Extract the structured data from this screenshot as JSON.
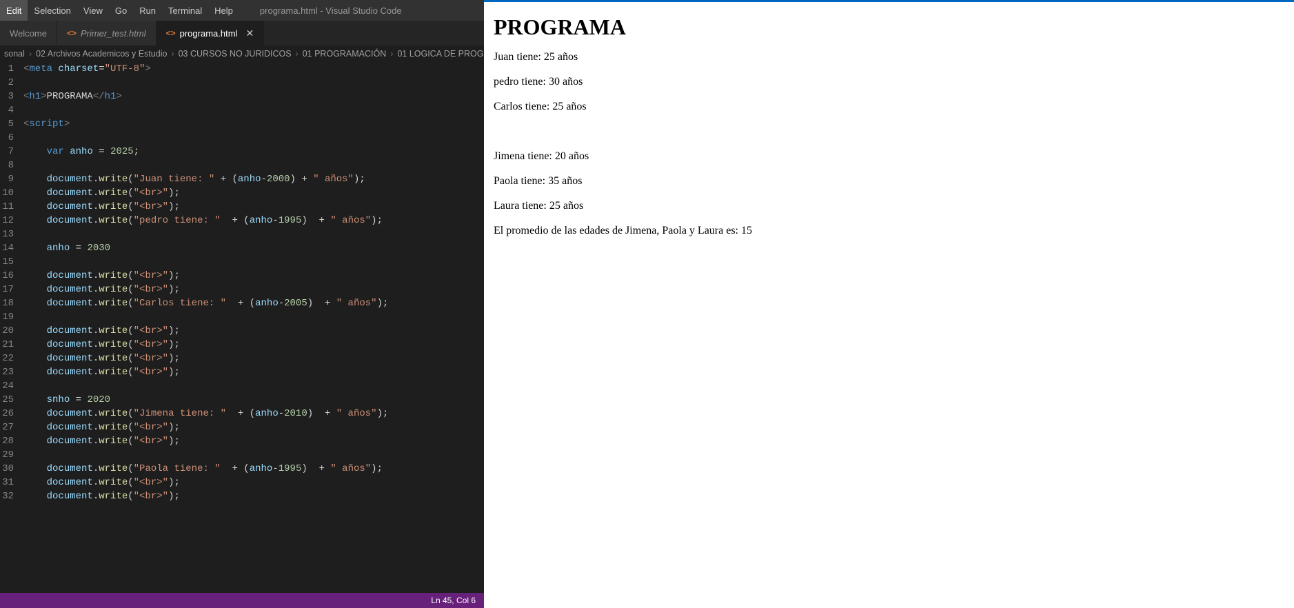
{
  "menubar": {
    "items": [
      "Edit",
      "Selection",
      "View",
      "Go",
      "Run",
      "Terminal",
      "Help"
    ],
    "title": "programa.html - Visual Studio Code"
  },
  "tabs": [
    {
      "label": "Welcome",
      "icon": "",
      "active": false,
      "welcome": true
    },
    {
      "label": "Primer_test.html",
      "icon": "<>",
      "active": false
    },
    {
      "label": "programa.html",
      "icon": "<>",
      "active": true,
      "close": "✕"
    }
  ],
  "breadcrumbs": [
    "sonal",
    "02 Archivos Academicos y Estudio",
    "03 CURSOS NO JURIDICOS",
    "01 PROGRAMACIÓN",
    "01 LOGICA DE PROG"
  ],
  "statusbar": {
    "position": "Ln 45, Col 6"
  },
  "code_lines": [
    {
      "n": 1,
      "html": "<span class='t-punct'>&lt;</span><span class='t-tag'>meta</span> <span class='t-attr'>charset</span><span class='t-txt'>=</span><span class='t-str'>\"UTF-8\"</span><span class='t-punct'>&gt;</span>"
    },
    {
      "n": 2,
      "html": ""
    },
    {
      "n": 3,
      "html": "<span class='t-punct'>&lt;</span><span class='t-tag'>h1</span><span class='t-punct'>&gt;</span><span class='t-txt'>PROGRAMA</span><span class='t-punct'>&lt;/</span><span class='t-tag'>h1</span><span class='t-punct'>&gt;</span>"
    },
    {
      "n": 4,
      "html": ""
    },
    {
      "n": 5,
      "html": "<span class='t-punct'>&lt;</span><span class='t-tag'>script</span><span class='t-punct'>&gt;</span>"
    },
    {
      "n": 6,
      "html": ""
    },
    {
      "n": 7,
      "html": "    <span class='t-tag'>var</span> <span class='t-attr'>anho</span> <span class='t-txt'>=</span> <span class='t-num'>2025</span><span class='t-txt'>;</span>"
    },
    {
      "n": 8,
      "html": ""
    },
    {
      "n": 9,
      "html": "    <span class='t-attr'>document</span><span class='t-txt'>.</span><span class='t-fn'>write</span><span class='t-txt'>(</span><span class='t-str'>\"Juan tiene: \"</span> <span class='t-txt'>+ (</span><span class='t-attr'>anho</span><span class='t-txt'>-</span><span class='t-num'>2000</span><span class='t-txt'>) + </span><span class='t-str'>\" años\"</span><span class='t-txt'>);</span>"
    },
    {
      "n": 10,
      "html": "    <span class='t-attr'>document</span><span class='t-txt'>.</span><span class='t-fn'>write</span><span class='t-txt'>(</span><span class='t-str'>\"&lt;br&gt;\"</span><span class='t-txt'>);</span>"
    },
    {
      "n": 11,
      "html": "    <span class='t-attr'>document</span><span class='t-txt'>.</span><span class='t-fn'>write</span><span class='t-txt'>(</span><span class='t-str'>\"&lt;br&gt;\"</span><span class='t-txt'>);</span>"
    },
    {
      "n": 12,
      "html": "    <span class='t-attr'>document</span><span class='t-txt'>.</span><span class='t-fn'>write</span><span class='t-txt'>(</span><span class='t-str'>\"pedro tiene: \"</span>  <span class='t-txt'>+ (</span><span class='t-attr'>anho</span><span class='t-txt'>-</span><span class='t-num'>1995</span><span class='t-txt'>)  + </span><span class='t-str'>\" años\"</span><span class='t-txt'>);</span>"
    },
    {
      "n": 13,
      "html": ""
    },
    {
      "n": 14,
      "html": "    <span class='t-attr'>anho</span> <span class='t-txt'>=</span> <span class='t-num'>2030</span>"
    },
    {
      "n": 15,
      "html": ""
    },
    {
      "n": 16,
      "html": "    <span class='t-attr'>document</span><span class='t-txt'>.</span><span class='t-fn'>write</span><span class='t-txt'>(</span><span class='t-str'>\"&lt;br&gt;\"</span><span class='t-txt'>);</span>"
    },
    {
      "n": 17,
      "html": "    <span class='t-attr'>document</span><span class='t-txt'>.</span><span class='t-fn'>write</span><span class='t-txt'>(</span><span class='t-str'>\"&lt;br&gt;\"</span><span class='t-txt'>);</span>"
    },
    {
      "n": 18,
      "html": "    <span class='t-attr'>document</span><span class='t-txt'>.</span><span class='t-fn'>write</span><span class='t-txt'>(</span><span class='t-str'>\"Carlos tiene: \"</span>  <span class='t-txt'>+ (</span><span class='t-attr'>anho</span><span class='t-txt'>-</span><span class='t-num'>2005</span><span class='t-txt'>)  + </span><span class='t-str'>\" años\"</span><span class='t-txt'>);</span>"
    },
    {
      "n": 19,
      "html": ""
    },
    {
      "n": 20,
      "html": "    <span class='t-attr'>document</span><span class='t-txt'>.</span><span class='t-fn'>write</span><span class='t-txt'>(</span><span class='t-str'>\"&lt;br&gt;\"</span><span class='t-txt'>);</span>"
    },
    {
      "n": 21,
      "html": "    <span class='t-attr'>document</span><span class='t-txt'>.</span><span class='t-fn'>write</span><span class='t-txt'>(</span><span class='t-str'>\"&lt;br&gt;\"</span><span class='t-txt'>);</span>"
    },
    {
      "n": 22,
      "html": "    <span class='t-attr'>document</span><span class='t-txt'>.</span><span class='t-fn'>write</span><span class='t-txt'>(</span><span class='t-str'>\"&lt;br&gt;\"</span><span class='t-txt'>);</span>"
    },
    {
      "n": 23,
      "html": "    <span class='t-attr'>document</span><span class='t-txt'>.</span><span class='t-fn'>write</span><span class='t-txt'>(</span><span class='t-str'>\"&lt;br&gt;\"</span><span class='t-txt'>);</span>"
    },
    {
      "n": 24,
      "html": ""
    },
    {
      "n": 25,
      "html": "    <span class='t-attr'>snho</span> <span class='t-txt'>=</span> <span class='t-num'>2020</span>"
    },
    {
      "n": 26,
      "html": "    <span class='t-attr'>document</span><span class='t-txt'>.</span><span class='t-fn'>write</span><span class='t-txt'>(</span><span class='t-str'>\"Jimena tiene: \"</span>  <span class='t-txt'>+ (</span><span class='t-attr'>anho</span><span class='t-txt'>-</span><span class='t-num'>2010</span><span class='t-txt'>)  + </span><span class='t-str'>\" años\"</span><span class='t-txt'>);</span>"
    },
    {
      "n": 27,
      "html": "    <span class='t-attr'>document</span><span class='t-txt'>.</span><span class='t-fn'>write</span><span class='t-txt'>(</span><span class='t-str'>\"&lt;br&gt;\"</span><span class='t-txt'>);</span>"
    },
    {
      "n": 28,
      "html": "    <span class='t-attr'>document</span><span class='t-txt'>.</span><span class='t-fn'>write</span><span class='t-txt'>(</span><span class='t-str'>\"&lt;br&gt;\"</span><span class='t-txt'>);</span>"
    },
    {
      "n": 29,
      "html": ""
    },
    {
      "n": 30,
      "html": "    <span class='t-attr'>document</span><span class='t-txt'>.</span><span class='t-fn'>write</span><span class='t-txt'>(</span><span class='t-str'>\"Paola tiene: \"</span>  <span class='t-txt'>+ (</span><span class='t-attr'>anho</span><span class='t-txt'>-</span><span class='t-num'>1995</span><span class='t-txt'>)  + </span><span class='t-str'>\" años\"</span><span class='t-txt'>);</span>"
    },
    {
      "n": 31,
      "html": "    <span class='t-attr'>document</span><span class='t-txt'>.</span><span class='t-fn'>write</span><span class='t-txt'>(</span><span class='t-str'>\"&lt;br&gt;\"</span><span class='t-txt'>);</span>"
    },
    {
      "n": 32,
      "html": "    <span class='t-attr'>document</span><span class='t-txt'>.</span><span class='t-fn'>write</span><span class='t-txt'>(</span><span class='t-str'>\"&lt;br&gt;\"</span><span class='t-txt'>);</span>"
    }
  ],
  "output": {
    "heading": "PROGRAMA",
    "lines1": [
      "Juan tiene: 25 años",
      "pedro tiene: 30 años",
      "Carlos tiene: 25 años"
    ],
    "lines2": [
      "Jimena tiene: 20 años",
      "Paola tiene: 35 años",
      "Laura tiene: 25 años",
      "El promedio de las edades de Jimena, Paola y Laura es: 15"
    ]
  }
}
